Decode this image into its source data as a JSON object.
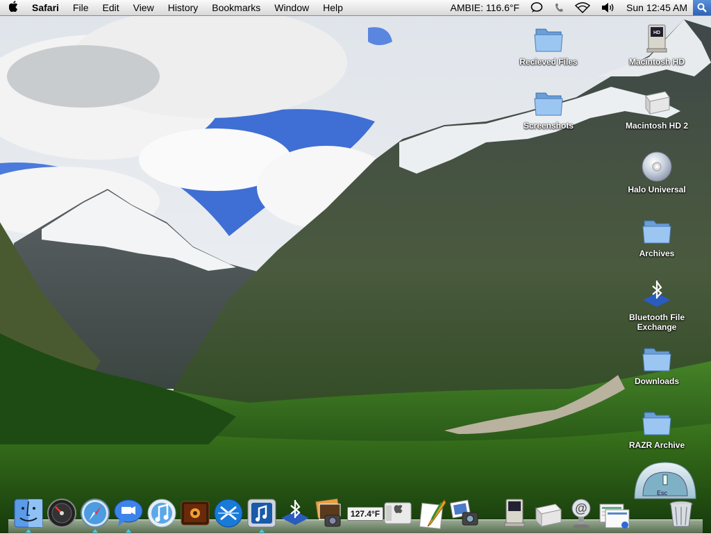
{
  "menubar": {
    "apple_icon": "apple-logo-icon",
    "app_name": "Safari",
    "items": [
      "File",
      "Edit",
      "View",
      "History",
      "Bookmarks",
      "Window",
      "Help"
    ],
    "status": {
      "temperature": "AMBIE: 116.6°F",
      "clock": "Sun 12:45 AM"
    },
    "status_icons": [
      "chat-icon",
      "phone-icon",
      "wifi-icon",
      "volume-icon",
      "spotlight-icon"
    ]
  },
  "desktop_icons": [
    {
      "label": "Recieved Files",
      "icon": "folder-icon"
    },
    {
      "label": "Screenshots",
      "icon": "folder-icon"
    },
    {
      "label": "Macintosh HD",
      "icon": "classic-mac-icon"
    },
    {
      "label": "Macintosh HD 2",
      "icon": "external-drive-icon"
    },
    {
      "label": "Halo Universal",
      "icon": "cd-disc-icon"
    },
    {
      "label": "Archives",
      "icon": "folder-icon"
    },
    {
      "label": "Bluetooth File Exchange",
      "icon": "bluetooth-icon"
    },
    {
      "label": "Downloads",
      "icon": "folder-icon"
    },
    {
      "label": "RAZR Archive",
      "icon": "folder-icon"
    }
  ],
  "dock": {
    "temperature_badge": "127.4°F",
    "esc_label": "Esc",
    "items": [
      "finder",
      "dashboard",
      "safari",
      "ichat",
      "itunes",
      "photo-booth",
      "xslimmer",
      "music-app",
      "bluetooth",
      "iphoto",
      "temperature-monitor",
      "boot-camp",
      "quill-app",
      "image-capture",
      "macintosh-hd",
      "drive",
      "mail",
      "documents-stack",
      "trash"
    ]
  }
}
